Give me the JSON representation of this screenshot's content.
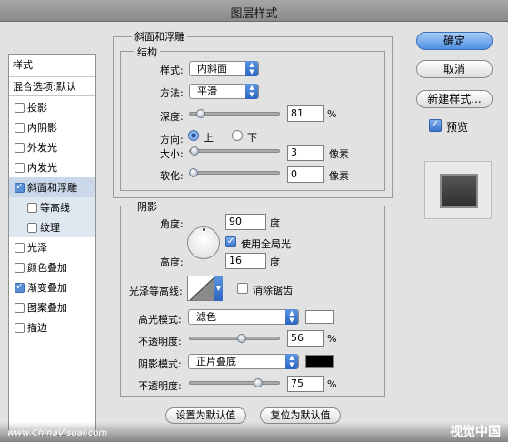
{
  "window": {
    "title": "图层样式"
  },
  "style_list": {
    "header": "样式",
    "blend_options": "混合选项:默认",
    "items": [
      {
        "label": "投影",
        "checked": false
      },
      {
        "label": "内阴影",
        "checked": false
      },
      {
        "label": "外发光",
        "checked": false
      },
      {
        "label": "内发光",
        "checked": false
      },
      {
        "label": "斜面和浮雕",
        "checked": true,
        "selected": true
      },
      {
        "label": "等高线",
        "checked": false,
        "sub": true
      },
      {
        "label": "纹理",
        "checked": false,
        "sub": true
      },
      {
        "label": "光泽",
        "checked": false
      },
      {
        "label": "颜色叠加",
        "checked": false
      },
      {
        "label": "渐变叠加",
        "checked": true
      },
      {
        "label": "图案叠加",
        "checked": false
      },
      {
        "label": "描边",
        "checked": false
      }
    ]
  },
  "bevel": {
    "group_title": "斜面和浮雕",
    "structure_title": "结构",
    "style_label": "样式:",
    "style_value": "内斜面",
    "method_label": "方法:",
    "method_value": "平滑",
    "depth_label": "深度:",
    "depth_value": "81",
    "depth_unit": "%",
    "depth_slider": 0.08,
    "direction_label": "方向:",
    "dir_up": "上",
    "dir_down": "下",
    "direction_value": "上",
    "size_label": "大小:",
    "size_value": "3",
    "size_unit": "像素",
    "size_slider": 0.01,
    "soften_label": "软化:",
    "soften_value": "0",
    "soften_unit": "像素",
    "soften_slider": 0.0
  },
  "shading": {
    "title": "阴影",
    "angle_label": "角度:",
    "angle_value": "90",
    "angle_unit": "度",
    "global_light_label": "使用全局光",
    "global_light_checked": true,
    "altitude_label": "高度:",
    "altitude_value": "16",
    "altitude_unit": "度",
    "gloss_contour_label": "光泽等高线:",
    "anti_alias_label": "消除锯齿",
    "anti_alias_checked": false,
    "highlight_mode_label": "高光模式:",
    "highlight_mode_value": "滤色",
    "highlight_color": "#ffffff",
    "highlight_opacity_label": "不透明度:",
    "highlight_opacity_value": "56",
    "highlight_opacity_unit": "%",
    "highlight_opacity_slider": 0.56,
    "shadow_mode_label": "阴影模式:",
    "shadow_mode_value": "正片叠底",
    "shadow_color": "#000000",
    "shadow_opacity_label": "不透明度:",
    "shadow_opacity_value": "75",
    "shadow_opacity_unit": "%",
    "shadow_opacity_slider": 0.75
  },
  "buttons": {
    "set_default": "设置为默认值",
    "reset_default": "复位为默认值",
    "ok": "确定",
    "cancel": "取消",
    "new_style": "新建样式...",
    "preview_label": "预览",
    "preview_checked": true
  },
  "watermark": {
    "left": "www.ChinaVisual.com",
    "right": "视觉中国"
  }
}
